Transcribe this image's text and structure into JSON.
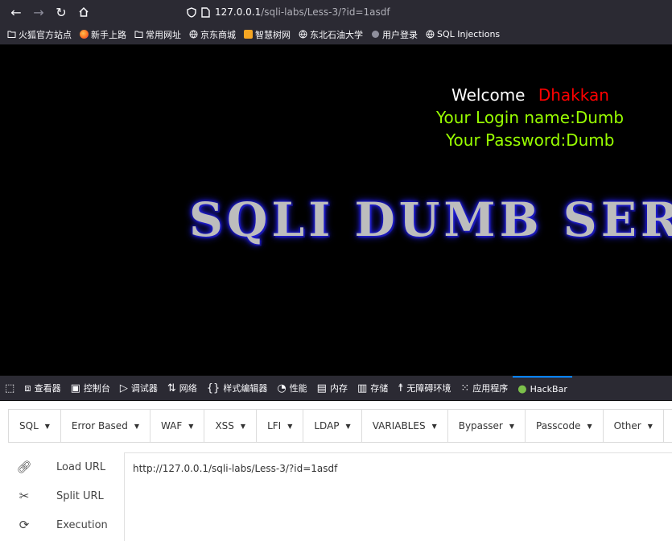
{
  "nav": {
    "back_icon": "arrow-left-icon",
    "forward_icon": "arrow-right-icon",
    "reload_icon": "reload-icon",
    "home_icon": "home-icon",
    "url_host": "127.0.0.1",
    "url_path": "/sqli-labs/Less-3/?id=1asdf"
  },
  "bookmarks": [
    {
      "label": "火狐官方站点",
      "icon": "folder-icon"
    },
    {
      "label": "新手上路",
      "icon": "firefox-icon"
    },
    {
      "label": "常用网址",
      "icon": "folder-icon"
    },
    {
      "label": "京东商城",
      "icon": "globe-icon"
    },
    {
      "label": "智慧树网",
      "icon": "zhihuishu-icon"
    },
    {
      "label": "东北石油大学",
      "icon": "globe-icon"
    },
    {
      "label": "用户登录",
      "icon": "globe-icon"
    },
    {
      "label": "SQL Injections",
      "icon": "globe-icon"
    }
  ],
  "page": {
    "welcome_label": "Welcome",
    "welcome_name": "Dhakkan",
    "login_line": "Your Login name:Dumb",
    "password_line": "Your Password:Dumb",
    "banner": "SQLI DUMB SERIES",
    "colors": {
      "welcome": "#ffffff",
      "name": "#ff0000",
      "login": "#99ff00",
      "banner_glow": "#1e1bd8"
    }
  },
  "devtools": {
    "tabs": [
      {
        "label": "",
        "icon": "picker-icon"
      },
      {
        "label": "查看器",
        "icon": "inspector-icon"
      },
      {
        "label": "控制台",
        "icon": "console-icon"
      },
      {
        "label": "调试器",
        "icon": "debugger-icon"
      },
      {
        "label": "网络",
        "icon": "network-icon"
      },
      {
        "label": "样式编辑器",
        "icon": "style-editor-icon"
      },
      {
        "label": "性能",
        "icon": "performance-icon"
      },
      {
        "label": "内存",
        "icon": "memory-icon"
      },
      {
        "label": "存储",
        "icon": "storage-icon"
      },
      {
        "label": "无障碍环境",
        "icon": "accessibility-icon"
      },
      {
        "label": "应用程序",
        "icon": "application-icon"
      },
      {
        "label": "HackBar",
        "icon": "hackbar-icon"
      }
    ]
  },
  "hackbar": {
    "menu": [
      "SQL",
      "Error Based",
      "WAF",
      "XSS",
      "LFI",
      "LDAP",
      "VARIABLES",
      "Bypasser",
      "Passcode",
      "Other"
    ],
    "actions": [
      {
        "label": "Load URL",
        "icon": "link-icon"
      },
      {
        "label": "Split URL",
        "icon": "scissors-icon"
      },
      {
        "label": "Execution",
        "icon": "execute-icon"
      }
    ],
    "url_value": "http://127.0.0.1/sqli-labs/Less-3/?id=1asdf"
  }
}
